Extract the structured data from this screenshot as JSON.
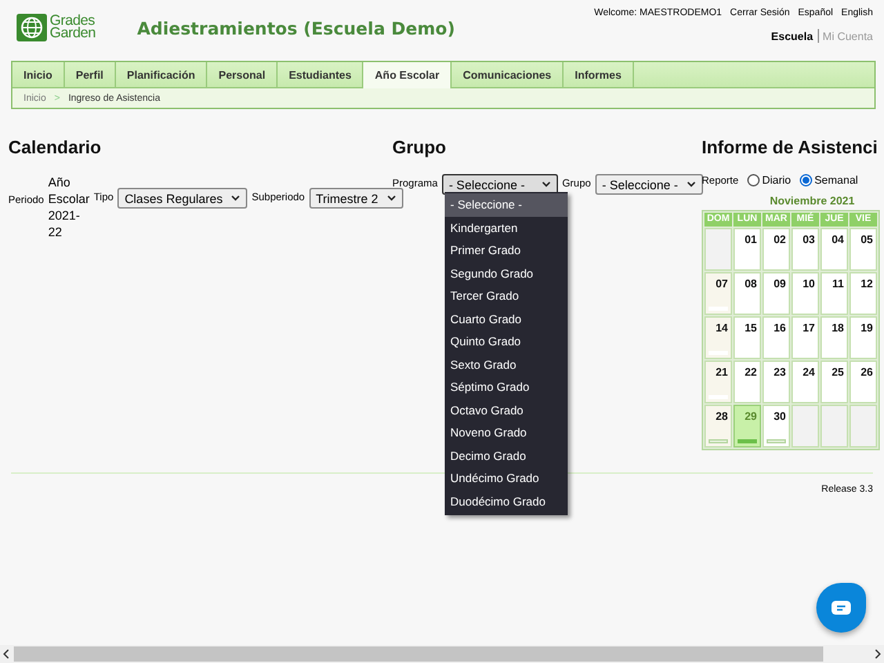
{
  "header": {
    "logo_text": [
      "Grades",
      "Garden"
    ],
    "title": "Adiestramientos (Escuela Demo)",
    "welcome": "Welcome: MAESTRODEMO1",
    "links": [
      "Cerrar Sesión",
      "Español",
      "English"
    ],
    "account_links": [
      {
        "label": "Escuela",
        "selected": true
      },
      {
        "label": "Mi Cuenta",
        "selected": false
      }
    ]
  },
  "nav": [
    {
      "label": "Inicio",
      "selected": false
    },
    {
      "label": "Perfil",
      "selected": false
    },
    {
      "label": "Planificación",
      "selected": false
    },
    {
      "label": "Personal",
      "selected": false
    },
    {
      "label": "Estudiantes",
      "selected": false
    },
    {
      "label": "Año Escolar",
      "selected": true
    },
    {
      "label": "Comunicaciones",
      "selected": false
    },
    {
      "label": "Informes",
      "selected": false
    }
  ],
  "breadcrumb": {
    "separator": ">",
    "items": [
      "Inicio",
      "Ingreso de Asistencia"
    ]
  },
  "calendario": {
    "heading": "Calendario",
    "periodo_label": "Periodo",
    "periodo_value": "Año Escolar 2021-22",
    "tipo_label": "Tipo",
    "tipo_value": "Clases Regulares",
    "subperiodo_label": "Subperiodo",
    "subperiodo_value": "Trimestre 2"
  },
  "grupo": {
    "heading": "Grupo",
    "programa_label": "Programa",
    "programa_value": "- Seleccione -",
    "grupo_label": "Grupo",
    "grupo_value": "- Seleccione -",
    "programa_options": [
      {
        "label": "- Seleccione -",
        "selected": true
      },
      {
        "label": "Kindergarten",
        "selected": false
      },
      {
        "label": "Primer Grado",
        "selected": false
      },
      {
        "label": "Segundo Grado",
        "selected": false
      },
      {
        "label": "Tercer Grado",
        "selected": false
      },
      {
        "label": "Cuarto Grado",
        "selected": false
      },
      {
        "label": "Quinto Grado",
        "selected": false
      },
      {
        "label": "Sexto Grado",
        "selected": false
      },
      {
        "label": "Séptimo Grado",
        "selected": false
      },
      {
        "label": "Octavo Grado",
        "selected": false
      },
      {
        "label": "Noveno Grado",
        "selected": false
      },
      {
        "label": "Decimo Grado",
        "selected": false
      },
      {
        "label": "Undécimo Grado",
        "selected": false
      },
      {
        "label": "Duodécimo Grado",
        "selected": false
      }
    ]
  },
  "informe": {
    "heading": "Informe de Asistenci",
    "reporte_label": "Reporte",
    "report_options": [
      {
        "label": "Diario",
        "selected": false
      },
      {
        "label": "Semanal",
        "selected": true
      }
    ],
    "calendar": {
      "month": "Noviembre 2021",
      "weekdays": [
        "DOM",
        "LUN",
        "MAR",
        "MIÉ",
        "JUE",
        "VIE"
      ],
      "weeks": [
        [
          {
            "selected": false
          },
          {
            "day": "01",
            "selected": false
          },
          {
            "day": "02",
            "selected": false
          },
          {
            "day": "03",
            "selected": false
          },
          {
            "day": "04",
            "selected": false
          },
          {
            "day": "05",
            "selected": false
          }
        ],
        [
          {
            "day": "07",
            "selected": false,
            "bar": true
          },
          {
            "day": "08",
            "selected": false
          },
          {
            "day": "09",
            "selected": false
          },
          {
            "day": "10",
            "selected": false
          },
          {
            "day": "11",
            "selected": false
          },
          {
            "day": "12",
            "selected": false
          }
        ],
        [
          {
            "day": "14",
            "selected": false,
            "bar": true
          },
          {
            "day": "15",
            "selected": false
          },
          {
            "day": "16",
            "selected": false
          },
          {
            "day": "17",
            "selected": false
          },
          {
            "day": "18",
            "selected": false
          },
          {
            "day": "19",
            "selected": false
          }
        ],
        [
          {
            "day": "21",
            "selected": false,
            "bar": true
          },
          {
            "day": "22",
            "selected": false
          },
          {
            "day": "23",
            "selected": false
          },
          {
            "day": "24",
            "selected": false
          },
          {
            "day": "25",
            "selected": false
          },
          {
            "day": "26",
            "selected": false
          }
        ],
        [
          {
            "day": "28",
            "selected": false,
            "bar": true,
            "bar_outlined": true
          },
          {
            "day": "29",
            "selected": true,
            "bar": true,
            "bar_filled": true
          },
          {
            "day": "30",
            "selected": false,
            "bar": true,
            "bar_outlined": true
          },
          {
            "selected": false
          },
          {
            "selected": false
          },
          {
            "selected": false
          }
        ]
      ]
    }
  },
  "footer": {
    "release": "Release 3.3"
  }
}
